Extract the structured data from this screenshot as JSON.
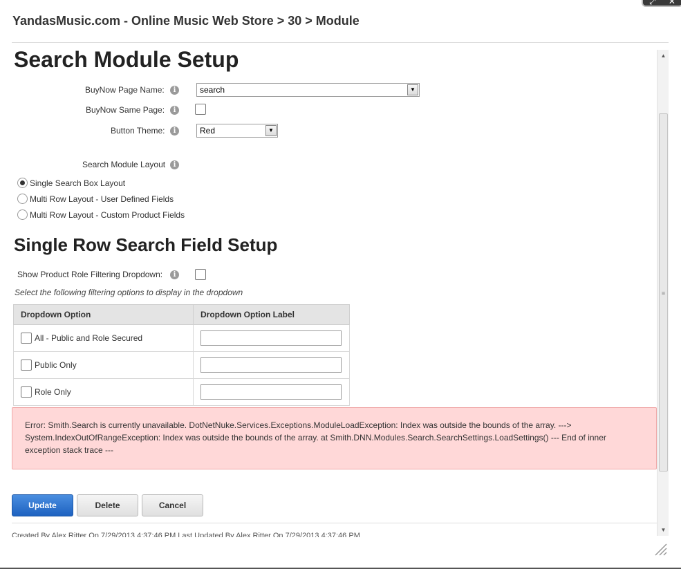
{
  "breadcrumb": "YandasMusic.com - Online Music Web Store > 30 > Module",
  "headings": {
    "main": "Search Module Setup",
    "single_row": "Single Row Search Field Setup"
  },
  "fields": {
    "buynow_page_name": {
      "label": "BuyNow Page Name:",
      "value": "search"
    },
    "buynow_same_page": {
      "label": "BuyNow Same Page:",
      "checked": false
    },
    "button_theme": {
      "label": "Button Theme:",
      "value": "Red"
    }
  },
  "layout": {
    "label": "Search Module Layout",
    "options": [
      {
        "label": "Single Search Box Layout",
        "selected": true
      },
      {
        "label": "Multi Row Layout - User Defined Fields",
        "selected": false
      },
      {
        "label": "Multi Row Layout - Custom Product Fields",
        "selected": false
      }
    ]
  },
  "role_filter": {
    "label": "Show Product Role Filtering Dropdown:",
    "checked": false,
    "hint": "Select the following filtering options to display in the dropdown"
  },
  "table": {
    "headers": [
      "Dropdown Option",
      "Dropdown Option Label"
    ],
    "rows": [
      {
        "option": "All - Public and Role Secured",
        "checked": false,
        "value": ""
      },
      {
        "option": "Public Only",
        "checked": false,
        "value": ""
      },
      {
        "option": "Role Only",
        "checked": false,
        "value": ""
      }
    ]
  },
  "error": "Error: Smith.Search is currently unavailable. DotNetNuke.Services.Exceptions.ModuleLoadException: Index was outside the bounds of the array. ---> System.IndexOutOfRangeException: Index was outside the bounds of the array. at Smith.DNN.Modules.Search.SearchSettings.LoadSettings() --- End of inner exception stack trace ---",
  "buttons": {
    "update": "Update",
    "delete": "Delete",
    "cancel": "Cancel"
  },
  "footer": "Created By Alex Ritter On 7/29/2013 4:37:46 PM      Last Updated By Alex Ritter On 7/29/2013 4:37:46 PM",
  "colors": {
    "primary_button": "#2a6fcf",
    "error_bg": "#ffd8d8",
    "table_header_bg": "#e4e4e4"
  }
}
